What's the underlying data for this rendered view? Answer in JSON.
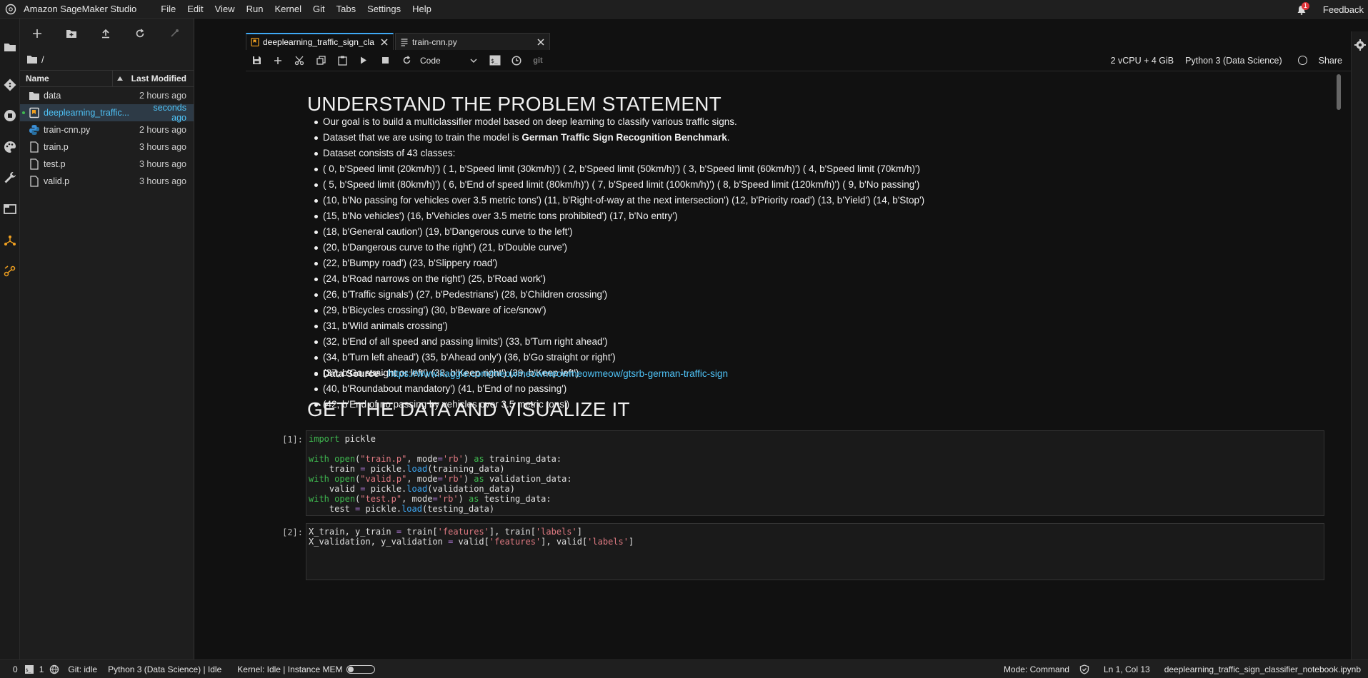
{
  "app": {
    "title": "Amazon SageMaker Studio"
  },
  "menubar": {
    "items": [
      "File",
      "Edit",
      "View",
      "Run",
      "Kernel",
      "Git",
      "Tabs",
      "Settings",
      "Help"
    ],
    "notification_count": "1",
    "feedback": "Feedback"
  },
  "filebrowser": {
    "path": "/",
    "col_name": "Name",
    "col_modified": "Last Modified",
    "files": [
      {
        "name": "data",
        "modified": "2 hours ago",
        "type": "folder",
        "icon": "folder-icon"
      },
      {
        "name": "deeplearning_traffic...",
        "modified": "seconds ago",
        "type": "notebook",
        "icon": "notebook-icon"
      },
      {
        "name": "train-cnn.py",
        "modified": "2 hours ago",
        "type": "python",
        "icon": "python-file-icon"
      },
      {
        "name": "train.p",
        "modified": "3 hours ago",
        "type": "file",
        "icon": "file-icon"
      },
      {
        "name": "test.p",
        "modified": "3 hours ago",
        "type": "file",
        "icon": "file-icon"
      },
      {
        "name": "valid.p",
        "modified": "3 hours ago",
        "type": "file",
        "icon": "file-icon"
      }
    ]
  },
  "tabs": [
    {
      "label": "deeplearning_traffic_sign_cla",
      "active": true
    },
    {
      "label": "train-cnn.py",
      "active": false
    }
  ],
  "nb_toolbar": {
    "cell_type": "Code",
    "instance": "2 vCPU + 4 GiB",
    "kernel": "Python 3 (Data Science)",
    "share": "Share",
    "git": "git"
  },
  "notebook": {
    "heading1": "UNDERSTAND THE PROBLEM STATEMENT",
    "goal": "Our goal is to build a multiclassifier model based on deep learning to classify various traffic signs.",
    "dataset_prefix": "Dataset that we are using to train the model is ",
    "dataset_name": "German Traffic Sign Recognition Benchmark",
    "dataset_suffix": ".",
    "classes_intro": "Dataset consists of 43 classes:",
    "classes": [
      "( 0, b'Speed limit (20km/h)') ( 1, b'Speed limit (30km/h)') ( 2, b'Speed limit (50km/h)') ( 3, b'Speed limit (60km/h)') ( 4, b'Speed limit (70km/h)')",
      "( 5, b'Speed limit (80km/h)') ( 6, b'End of speed limit (80km/h)') ( 7, b'Speed limit (100km/h)') ( 8, b'Speed limit (120km/h)') ( 9, b'No passing')",
      "(10, b'No passing for vehicles over 3.5 metric tons') (11, b'Right-of-way at the next intersection') (12, b'Priority road') (13, b'Yield') (14, b'Stop')",
      "(15, b'No vehicles') (16, b'Vehicles over 3.5 metric tons prohibited') (17, b'No entry')",
      "(18, b'General caution') (19, b'Dangerous curve to the left')",
      "(20, b'Dangerous curve to the right') (21, b'Double curve')",
      "(22, b'Bumpy road') (23, b'Slippery road')",
      "(24, b'Road narrows on the right') (25, b'Road work')",
      "(26, b'Traffic signals') (27, b'Pedestrians') (28, b'Children crossing')",
      "(29, b'Bicycles crossing') (30, b'Beware of ice/snow')",
      "(31, b'Wild animals crossing')",
      "(32, b'End of all speed and passing limits') (33, b'Turn right ahead')",
      "(34, b'Turn left ahead') (35, b'Ahead only') (36, b'Go straight or right')",
      "(37, b'Go straight or left') (38, b'Keep right') (39, b'Keep left')",
      "(40, b'Roundabout mandatory') (41, b'End of no passing')",
      "(42, b'End of no passing by vehicles over 3.5 metric tons')"
    ],
    "data_source_label": "Data Source",
    "data_source_sep": " - ",
    "data_source_url": "https://www.kaggle.com/meowmeowmeowmeowmeow/gtsrb-german-traffic-sign",
    "heading2": "GET THE DATA AND VISUALIZE IT",
    "cell1_prompt": "[1]:",
    "cell2_prompt": "[2]:"
  },
  "statusbar": {
    "terminals": "0",
    "kernels": "1",
    "git": "Git: idle",
    "kernel_status": "Python 3 (Data Science) | Idle",
    "kernel_idle": "Kernel: Idle | Instance MEM",
    "mode": "Mode: Command",
    "position": "Ln 1, Col 13",
    "filename": "deeplearning_traffic_sign_classifier_notebook.ipynb"
  },
  "colors": {
    "accent": "#3fa9f5",
    "link": "#4fc3f7",
    "keyword": "#3fb950",
    "string": "#e07a82",
    "operator": "#b07ad8",
    "badge": "#e0343a"
  }
}
